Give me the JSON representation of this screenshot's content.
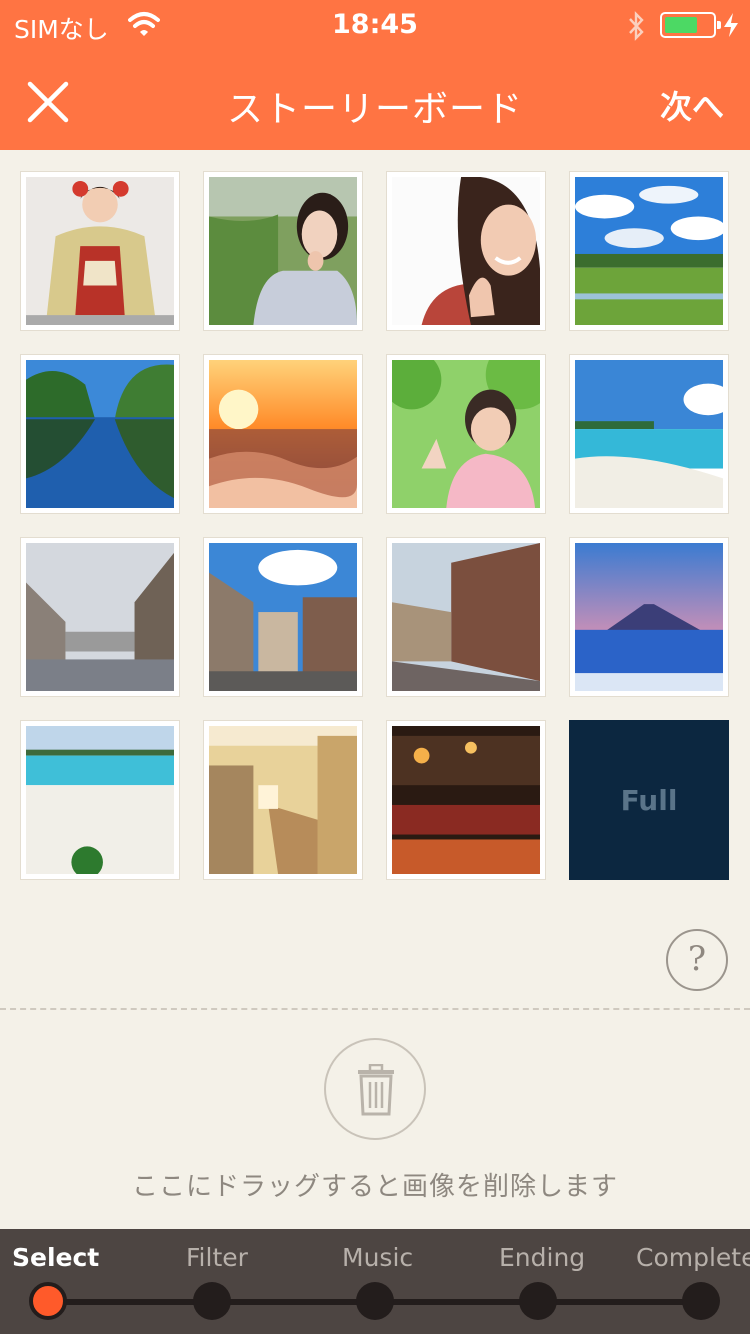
{
  "status": {
    "carrier": "SIMなし",
    "time": "18:45",
    "battery_level": 0.7,
    "battery_color": "#4cd964"
  },
  "nav": {
    "title": "ストーリーボード",
    "next_label": "次へ",
    "close_icon": "close-icon"
  },
  "grid": {
    "tiles": [
      {
        "subject": "kimono-woman"
      },
      {
        "subject": "woman-outdoors"
      },
      {
        "subject": "smiling-woman"
      },
      {
        "subject": "green-field-sky"
      },
      {
        "subject": "lake-reflection"
      },
      {
        "subject": "ocean-sunset"
      },
      {
        "subject": "woman-under-tree"
      },
      {
        "subject": "tropical-beach"
      },
      {
        "subject": "european-street"
      },
      {
        "subject": "old-town-buildings"
      },
      {
        "subject": "brick-street"
      },
      {
        "subject": "mount-fuji-sea"
      },
      {
        "subject": "beach-watermelon"
      },
      {
        "subject": "cafe-counter"
      },
      {
        "subject": "restaurant-interior"
      }
    ],
    "full_label": "Full"
  },
  "help": {
    "glyph": "?"
  },
  "trash": {
    "icon": "trash-icon",
    "label": "ここにドラッグすると画像を削除します"
  },
  "steps": [
    {
      "label": "Select",
      "active": true
    },
    {
      "label": "Filter",
      "active": false
    },
    {
      "label": "Music",
      "active": false
    },
    {
      "label": "Ending",
      "active": false
    },
    {
      "label": "Complete",
      "active": false
    }
  ],
  "colors": {
    "accent": "#ff7443",
    "background": "#f4f1e8",
    "stepbar": "#4d4542",
    "active_step": "#ff5a2a",
    "full_tile": "#0c2740"
  }
}
